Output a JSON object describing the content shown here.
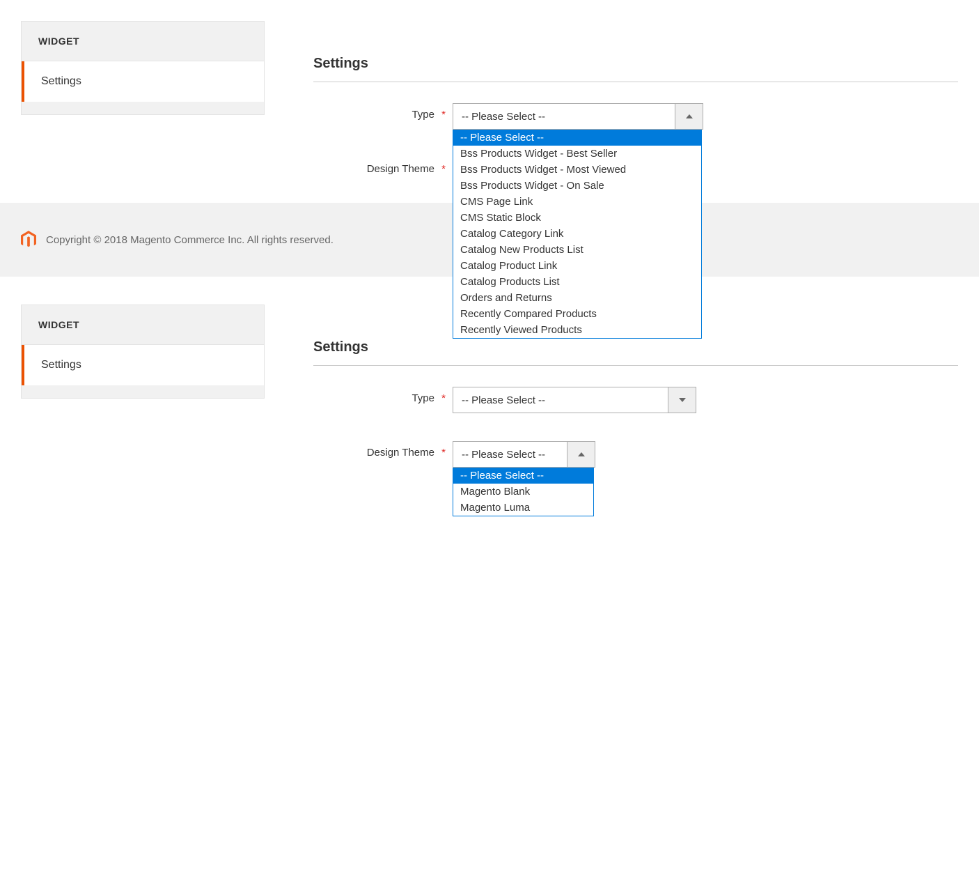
{
  "section1": {
    "sidebar": {
      "title": "WIDGET",
      "item": "Settings"
    },
    "settings_title": "Settings",
    "fields": {
      "type": {
        "label": "Type",
        "selected": "-- Please Select --",
        "options": [
          "-- Please Select --",
          "Bss Products Widget - Best Seller",
          "Bss Products Widget - Most Viewed",
          "Bss Products Widget - On Sale",
          "CMS Page Link",
          "CMS Static Block",
          "Catalog Category Link",
          "Catalog New Products List",
          "Catalog Product Link",
          "Catalog Products List",
          "Orders and Returns",
          "Recently Compared Products",
          "Recently Viewed Products"
        ]
      },
      "theme": {
        "label": "Design Theme"
      }
    }
  },
  "footer": {
    "copyright": "Copyright © 2018 Magento Commerce Inc. All rights reserved."
  },
  "section2": {
    "sidebar": {
      "title": "WIDGET",
      "item": "Settings"
    },
    "settings_title": "Settings",
    "fields": {
      "type": {
        "label": "Type",
        "selected": "-- Please Select --"
      },
      "theme": {
        "label": "Design Theme",
        "selected": "-- Please Select --",
        "options": [
          "-- Please Select --",
          "Magento Blank",
          "Magento Luma"
        ]
      }
    }
  }
}
